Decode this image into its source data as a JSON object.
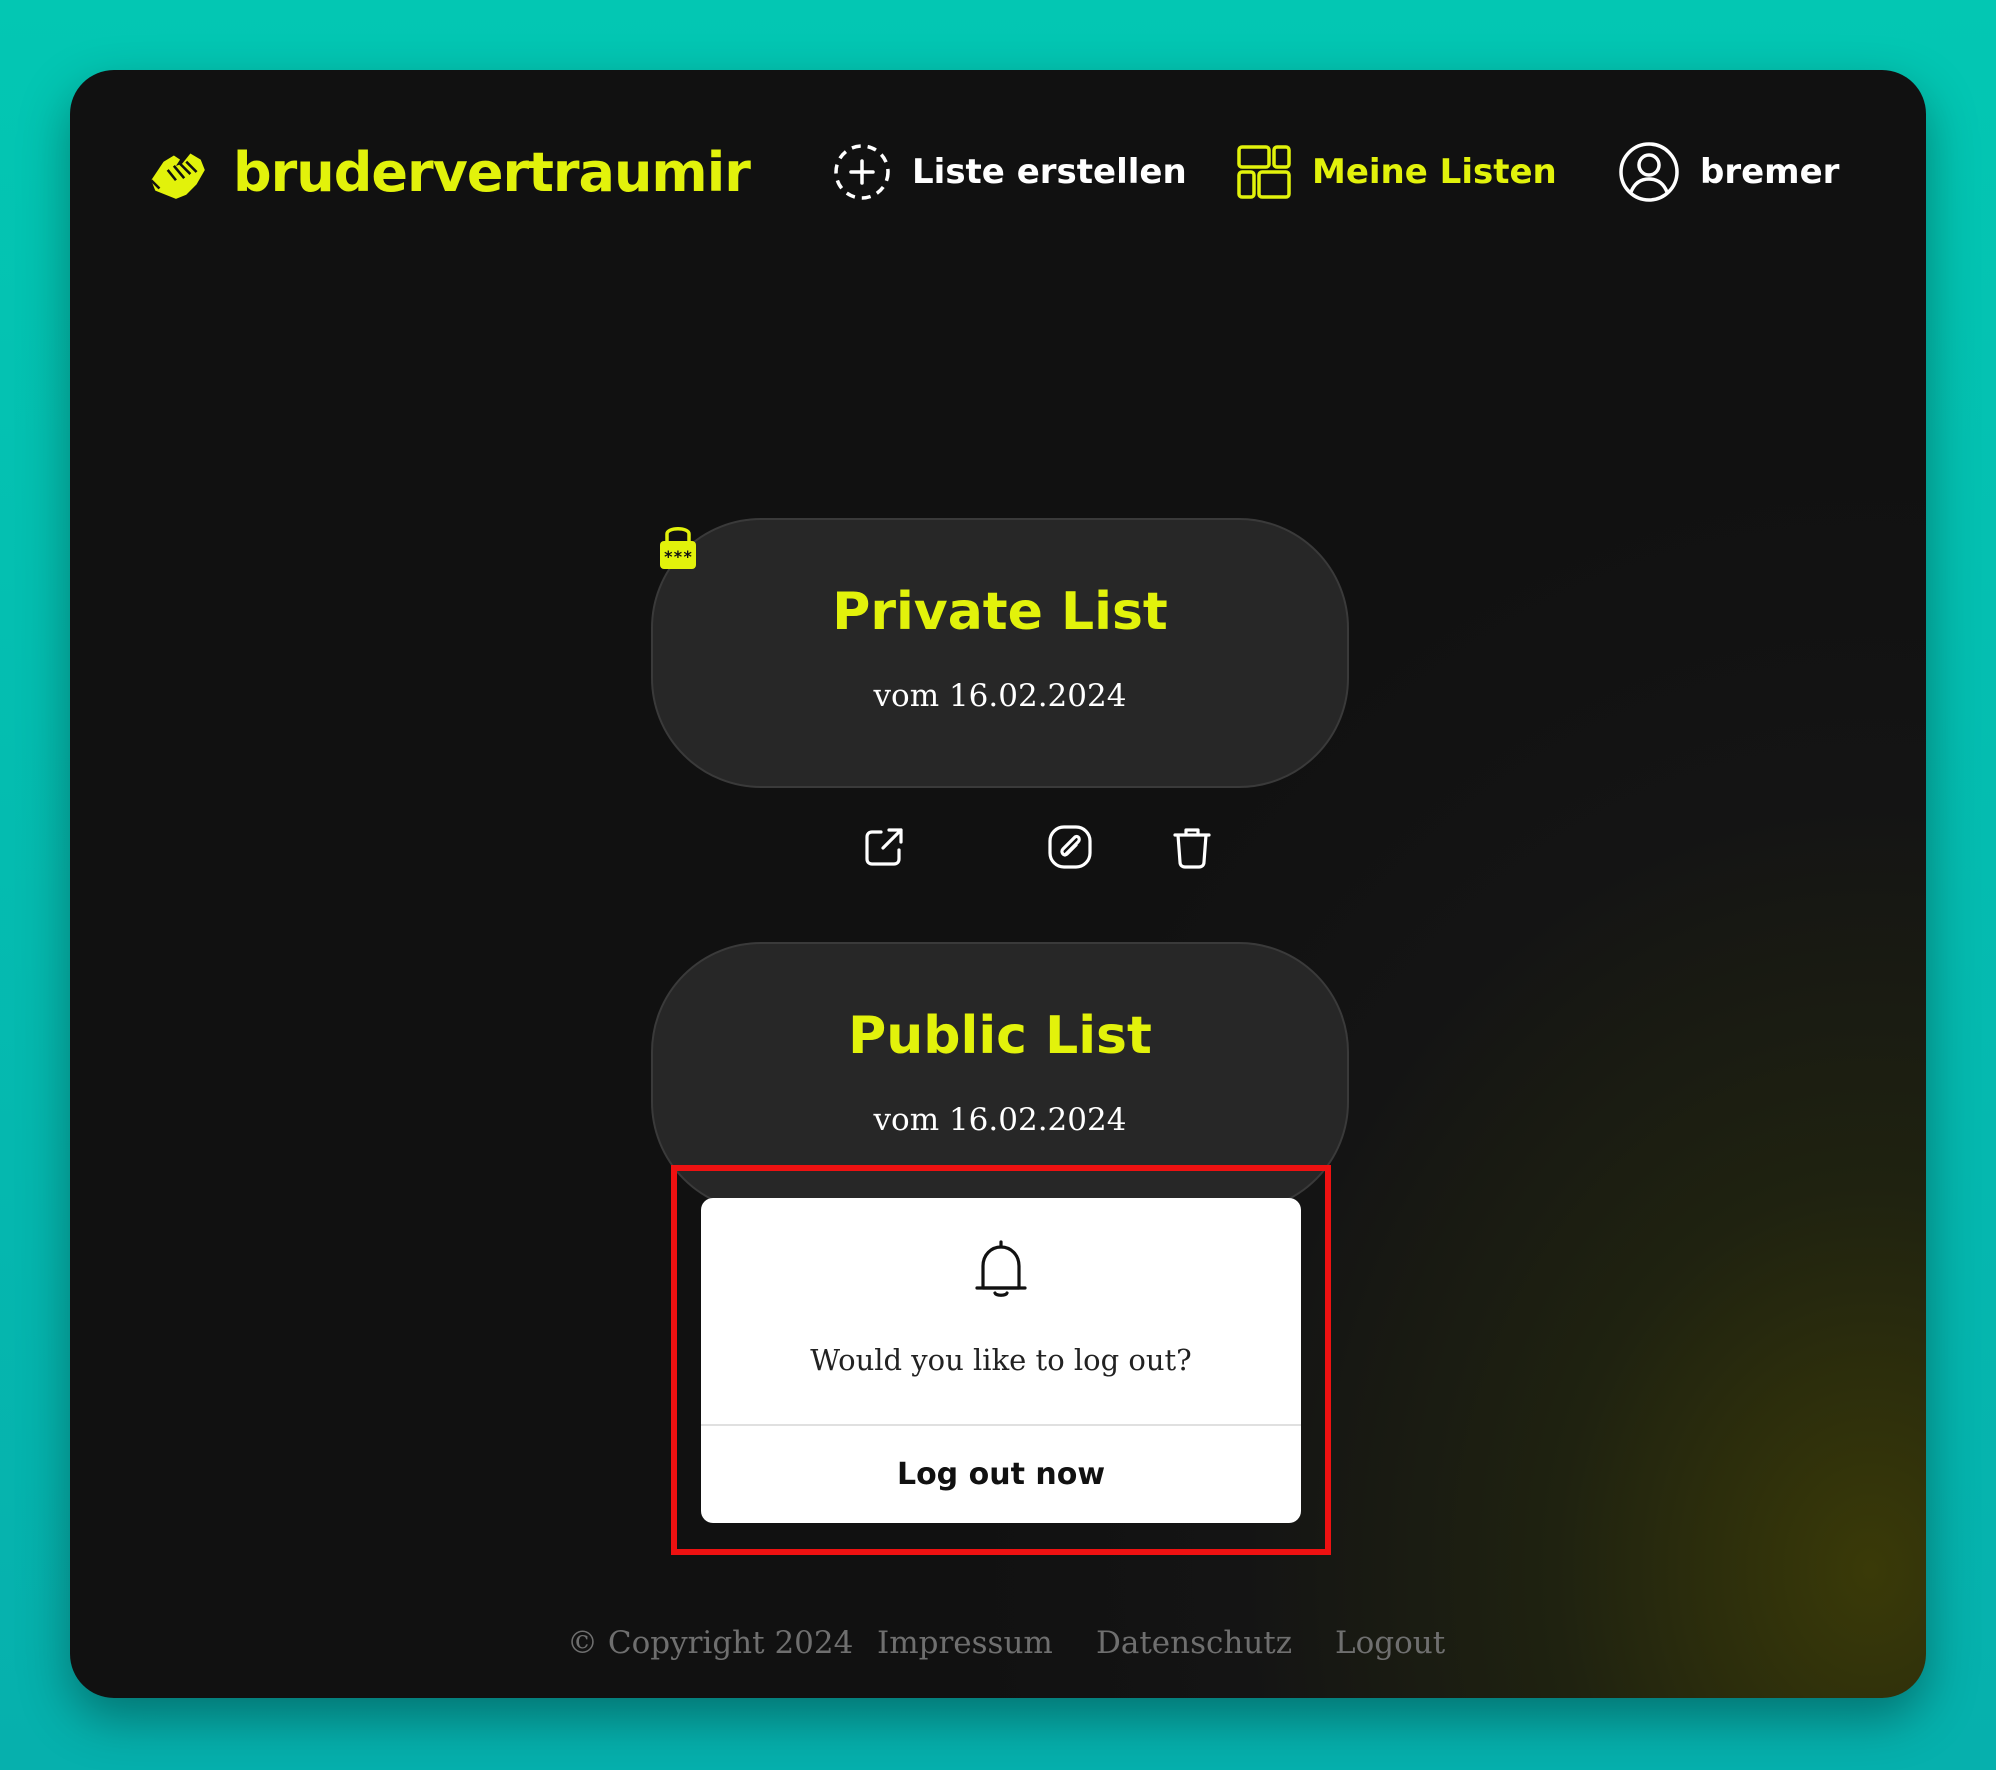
{
  "brand": {
    "name": "brudervertraumir",
    "icon": "handshake-icon"
  },
  "nav": {
    "create": {
      "label": "Liste erstellen",
      "icon": "dashed-plus-circle-icon"
    },
    "my_lists": {
      "label": "Meine Listen",
      "icon": "dashboard-grid-icon",
      "active": true
    },
    "user": {
      "label": "bremer",
      "icon": "user-circle-icon"
    }
  },
  "lists": [
    {
      "title": "Private List",
      "date": "vom 16.02.2024",
      "private": true,
      "icon": "lock-icon"
    },
    {
      "title": "Public List",
      "date": "vom 16.02.2024",
      "private": false
    }
  ],
  "actions": {
    "open": {
      "icon": "external-link-icon"
    },
    "copy_link": {
      "icon": "link-icon"
    },
    "delete": {
      "icon": "trash-icon"
    }
  },
  "dialog": {
    "icon": "bell-icon",
    "message": "Would you like to log out?",
    "confirm_label": "Log out now"
  },
  "footer": {
    "copyright": "© Copyright 2024",
    "impressum": "Impressum",
    "datenschutz": "Datenschutz",
    "logout": "Logout"
  },
  "colors": {
    "accent": "#e2f20b",
    "background": "#111111",
    "card": "#272727",
    "highlight": "#ee1111",
    "page_bg": "#03c7b3"
  }
}
